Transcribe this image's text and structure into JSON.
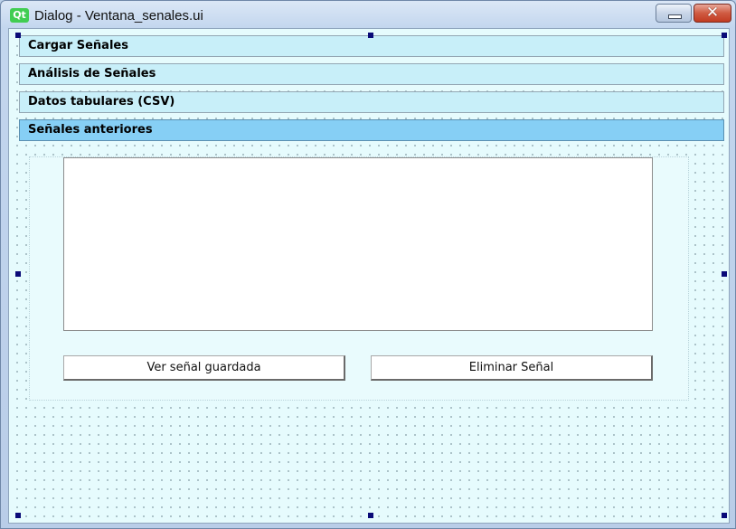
{
  "window": {
    "logo_text": "Qt",
    "title": "Dialog - Ventana_senales.ui",
    "close_glyph": "✕"
  },
  "toolbox": {
    "pages": [
      {
        "label": "Cargar Señales",
        "active": false
      },
      {
        "label": "Análisis de Señales",
        "active": false
      },
      {
        "label": "Datos tabulares (CSV)",
        "active": false
      },
      {
        "label": "Señales anteriores",
        "active": true
      }
    ]
  },
  "page_content": {
    "list_items": [],
    "view_button_label": "Ver señal guardada",
    "delete_button_label": "Eliminar Señal"
  },
  "colors": {
    "header": "#c8eff9",
    "header_active": "#86cff5",
    "canvas": "#e6fbfd",
    "selection_handle": "#0a0a78"
  }
}
